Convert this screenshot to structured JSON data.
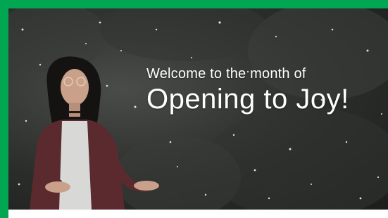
{
  "banner": {
    "line1": "Welcome to the month of",
    "line2": "Opening to Joy!",
    "photo": "woman-catching-snow-photo"
  },
  "colors": {
    "border": "#00a651",
    "text": "#ffffff"
  }
}
